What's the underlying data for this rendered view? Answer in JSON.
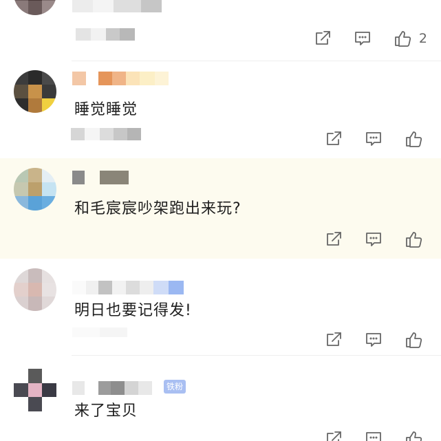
{
  "comments": [
    {
      "text": "",
      "likes": "2"
    },
    {
      "text": "睡觉睡觉",
      "likes": ""
    },
    {
      "text": "和毛宸宸吵架跑出来玩?",
      "likes": ""
    },
    {
      "text": "明日也要记得发!",
      "likes": ""
    },
    {
      "text": "来了宝贝",
      "likes": "",
      "badge": "铁粉"
    }
  ],
  "icons": {
    "share": "share-icon",
    "reply": "comment-icon",
    "like": "thumbs-up-icon"
  },
  "colors": {
    "highlight_background": "#fdfbef",
    "icon_gray": "#666666",
    "text": "#1e1e1e",
    "fan_badge": "#a9bff2"
  }
}
